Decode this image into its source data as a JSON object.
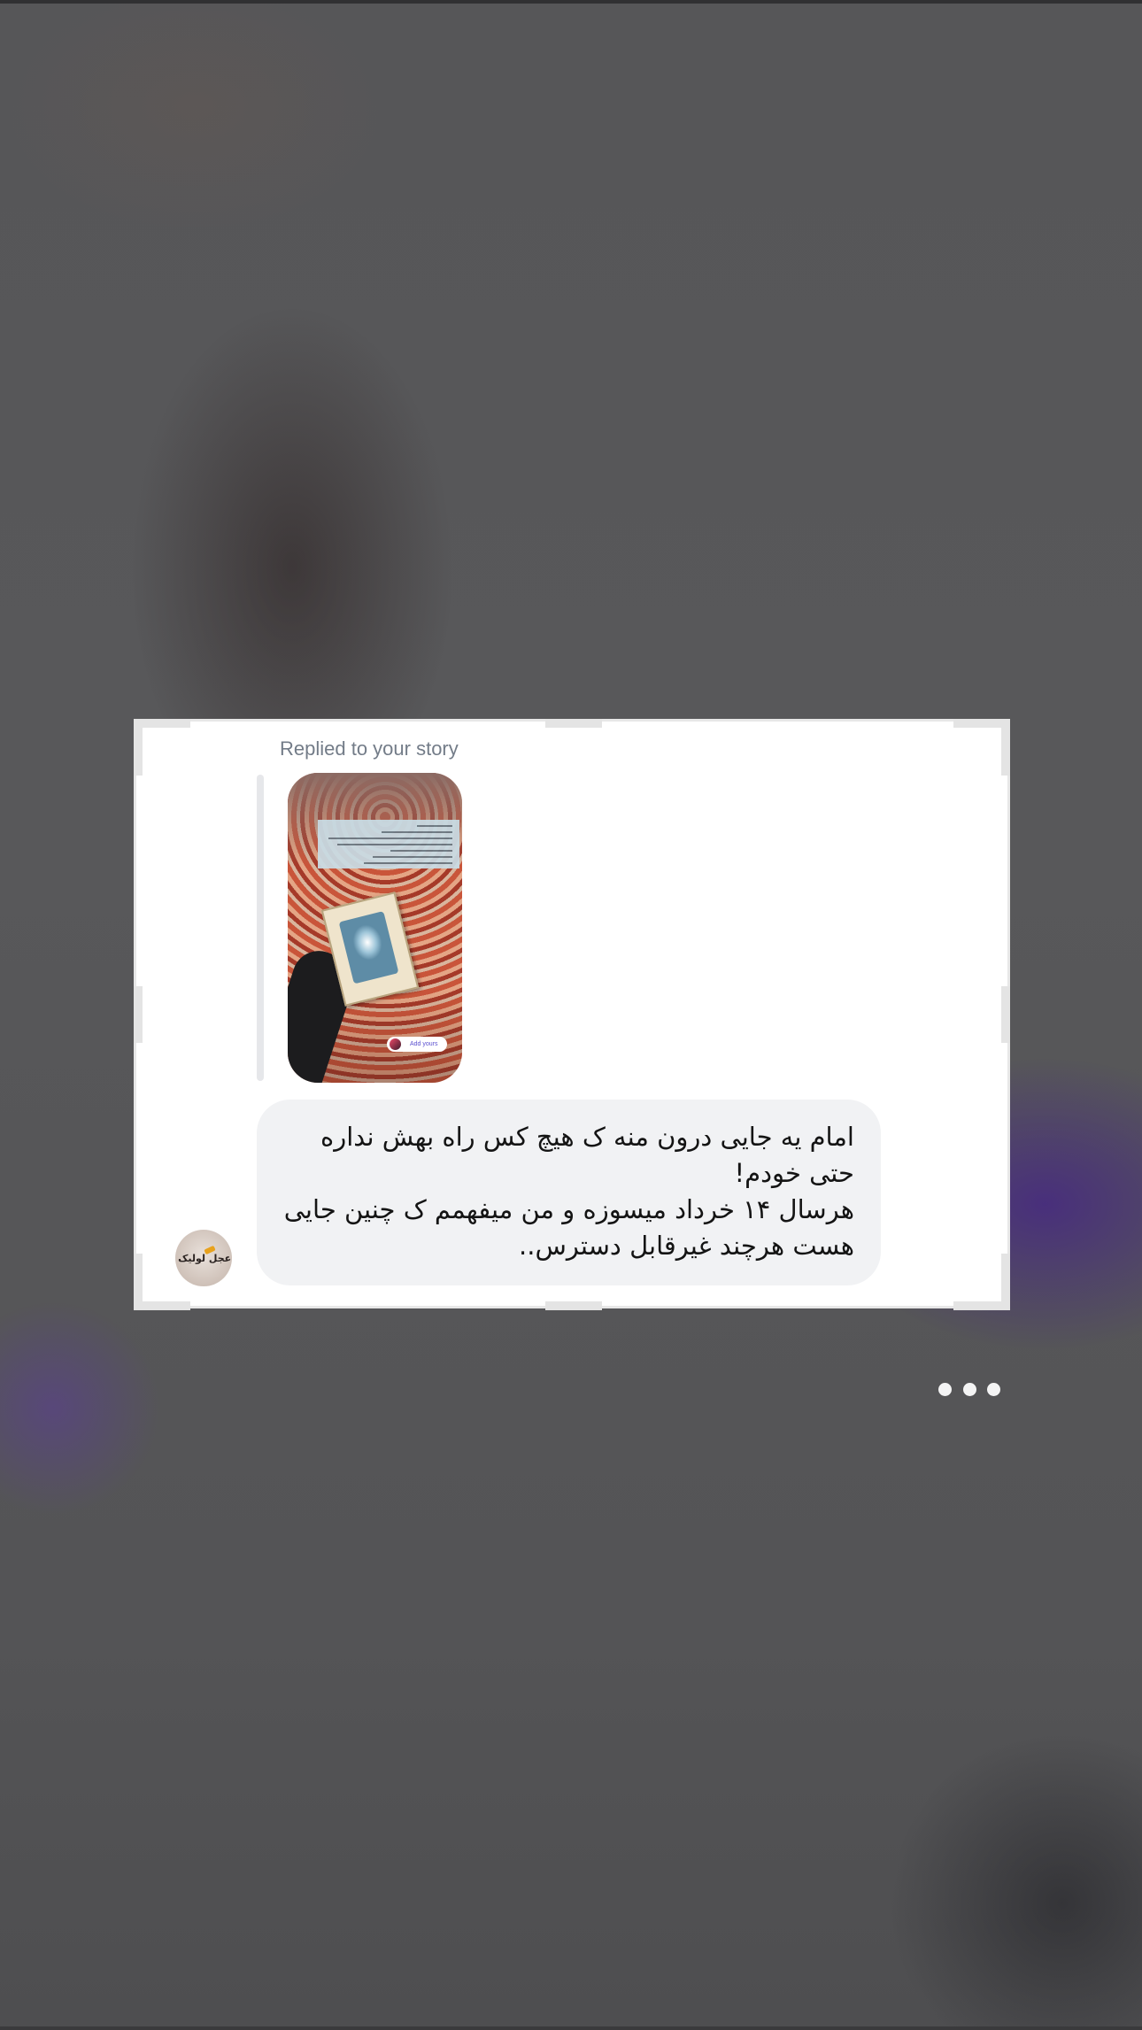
{
  "story_reply": {
    "label": "Replied to your story",
    "thumbnail": {
      "sticker_label": "Add yours"
    }
  },
  "message": {
    "text": "امام یه جایی درون منه ک هیچ کس راه بهش نداره\nحتی خودم!\nهرسال ۱۴ خرداد میسوزه و من میفهمم ک چنین جایی\nهست هرچند غیرقابل دسترس.."
  },
  "avatar": {
    "logo_text": "اللهم عجل لولیک الفرج"
  },
  "icons": {
    "more": "more-horizontal-icon"
  },
  "colors": {
    "bubble": "#f1f2f4",
    "label": "#737c88",
    "crop_handles": "#e4e4e4"
  }
}
